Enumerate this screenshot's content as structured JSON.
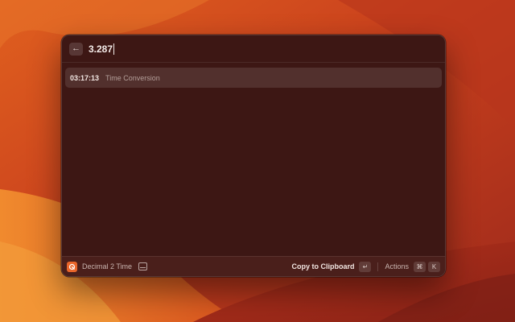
{
  "search": {
    "value": "3.287",
    "back_glyph": "←"
  },
  "results": [
    {
      "title": "03:17:13",
      "subtitle": "Time Conversion"
    }
  ],
  "footer": {
    "extension_icon": "raycast-extension-icon",
    "extension_name": "Decimal 2 Time",
    "primary_action": "Copy to Clipboard",
    "enter_key": "↵",
    "actions_label": "Actions",
    "shortcut_cmd": "⌘",
    "shortcut_key": "K"
  },
  "colors": {
    "window_bg": "#3d1714",
    "accent": "#e9652a",
    "wallpaper": "#c94a1c"
  }
}
